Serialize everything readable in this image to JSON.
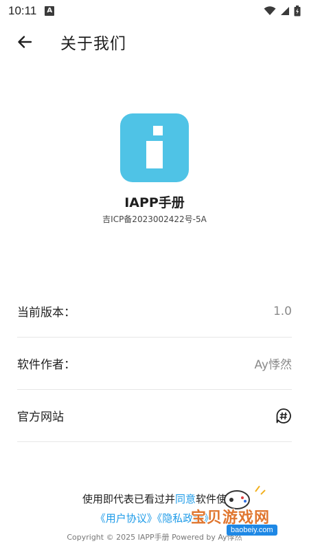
{
  "status_bar": {
    "time": "10:11",
    "notification_glyph": "A"
  },
  "header": {
    "title": "关于我们"
  },
  "app": {
    "name": "IAPP手册",
    "icp": "吉ICP备2023002422号-5A",
    "logo_color": "#4fc3e6"
  },
  "info": {
    "rows": [
      {
        "label": "当前版本：",
        "value": "1.0"
      },
      {
        "label": "软件作者：",
        "value": "Ay悸然"
      },
      {
        "label": "官方网站",
        "value": ""
      }
    ]
  },
  "footer": {
    "agree_prefix": "使用即代表已看过并",
    "agree_link": "同意",
    "agree_suffix": "软件使",
    "user_agreement": "《用户协议》",
    "privacy_policy": "《隐私政策》",
    "copyright": "Copyright © 2025 IAPP手册 Powered by Ay悸然"
  },
  "watermark": {
    "text": "宝贝游戏网",
    "url": "baobeiy.com"
  },
  "colors": {
    "link": "#1e9be8",
    "accent": "#4fc3e6"
  }
}
